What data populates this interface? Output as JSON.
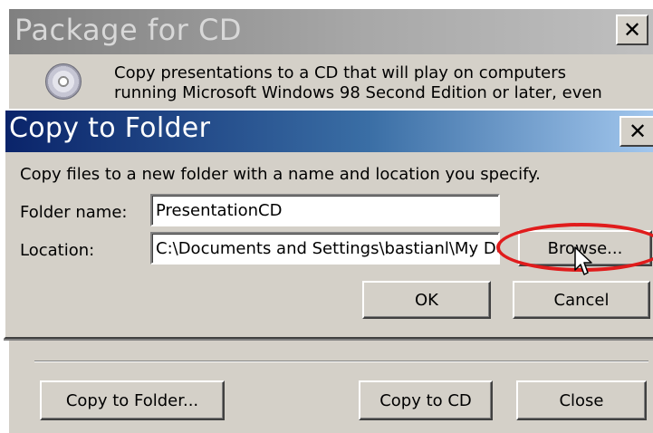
{
  "package_dialog": {
    "title": "Package for CD",
    "close_glyph": "✕",
    "description": "Copy presentations to a CD that will play on computers running Microsoft Windows 98 Second Edition or later, even",
    "buttons": {
      "copy_to_folder": "Copy to Folder...",
      "copy_to_cd": "Copy to CD",
      "close": "Close"
    },
    "icon": "cd-icon"
  },
  "copy_dialog": {
    "title": "Copy to Folder",
    "close_glyph": "✕",
    "description": "Copy files to a new folder with a name and location you specify.",
    "folder_name": {
      "label": "Folder name:",
      "value": "PresentationCD"
    },
    "location": {
      "label": "Location:",
      "value": "C:\\Documents and Settings\\bastianl\\My Documents"
    },
    "buttons": {
      "browse": "Browse...",
      "ok": "OK",
      "cancel": "Cancel"
    }
  },
  "annotation": {
    "highlight_color": "#e01c1c",
    "highlight_target": "browse-button"
  },
  "colors": {
    "dialog_face": "#d4d0c8",
    "active_title_start": "#0a246a",
    "active_title_end": "#a6caf0",
    "inactive_title": "#808080"
  }
}
